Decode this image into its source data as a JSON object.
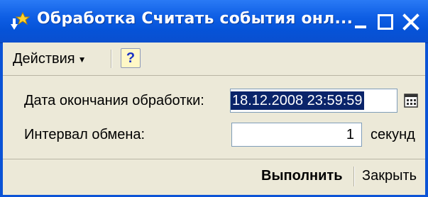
{
  "window": {
    "title": "Обработка  Считать события онл...",
    "icon": "processing-icon",
    "controls": [
      "minimize-icon",
      "maximize-icon",
      "close-icon"
    ],
    "title_color": "#0b53d6"
  },
  "toolbar": {
    "actions_label": "Действия",
    "help_label": "?"
  },
  "form": {
    "end_date_label": "Дата окончания обработки:",
    "end_date_value": "18.12.2008 23:59:59",
    "interval_label": "Интервал обмена:",
    "interval_value": "1",
    "interval_unit": "секунд"
  },
  "buttons": {
    "run_label": "Выполнить",
    "close_label": "Закрыть"
  }
}
